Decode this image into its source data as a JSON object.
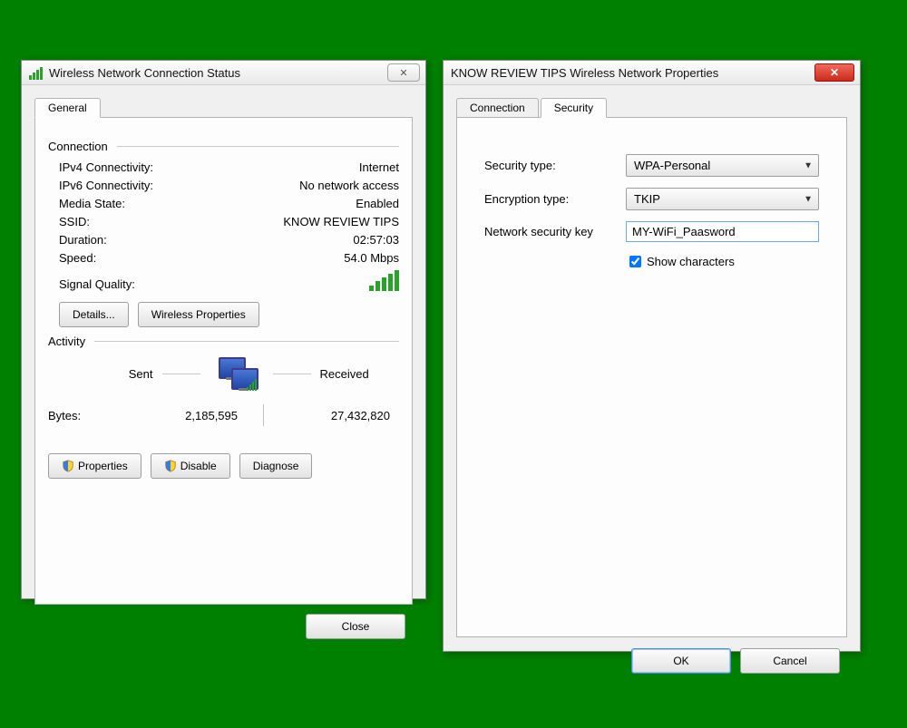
{
  "dialog1": {
    "title": "Wireless Network Connection Status",
    "tabs": {
      "general": "General"
    },
    "groups": {
      "connection": "Connection",
      "activity": "Activity"
    },
    "conn": {
      "ipv4_label": "IPv4 Connectivity:",
      "ipv4_value": "Internet",
      "ipv6_label": "IPv6 Connectivity:",
      "ipv6_value": "No network access",
      "media_label": "Media State:",
      "media_value": "Enabled",
      "ssid_label": "SSID:",
      "ssid_value": "KNOW REVIEW TIPS",
      "duration_label": "Duration:",
      "duration_value": "02:57:03",
      "speed_label": "Speed:",
      "speed_value": "54.0 Mbps",
      "signal_label": "Signal Quality:"
    },
    "buttons": {
      "details": "Details...",
      "wireless_props": "Wireless Properties",
      "properties": "Properties",
      "disable": "Disable",
      "diagnose": "Diagnose",
      "close": "Close"
    },
    "activity": {
      "sent_label": "Sent",
      "received_label": "Received",
      "bytes_label": "Bytes:",
      "sent_value": "2,185,595",
      "received_value": "27,432,820"
    }
  },
  "dialog2": {
    "title": "KNOW REVIEW TIPS Wireless Network Properties",
    "tabs": {
      "connection": "Connection",
      "security": "Security"
    },
    "form": {
      "security_type_label": "Security type:",
      "security_type_value": "WPA-Personal",
      "encryption_type_label": "Encryption type:",
      "encryption_type_value": "TKIP",
      "key_label": "Network security key",
      "key_value": "MY-WiFi_Paasword",
      "show_chars_label": "Show characters"
    },
    "buttons": {
      "ok": "OK",
      "cancel": "Cancel"
    }
  }
}
